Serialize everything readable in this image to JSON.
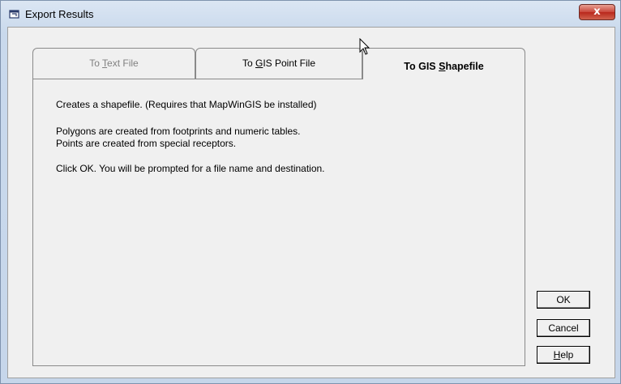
{
  "window": {
    "title": "Export Results",
    "close_label": "x"
  },
  "tabs": [
    {
      "label_prefix": "To ",
      "label_mnemonic": "T",
      "label_suffix": "ext File",
      "state": "disabled"
    },
    {
      "label_prefix": "To ",
      "label_mnemonic": "G",
      "label_suffix": "IS Point File",
      "state": "inactive"
    },
    {
      "label_prefix": "To GIS ",
      "label_mnemonic": "S",
      "label_suffix": "hapefile",
      "state": "active"
    }
  ],
  "panel": {
    "line1": "Creates a shapefile. (Requires that MapWinGIS be installed)",
    "line2": "Polygons are created from footprints and numeric tables.",
    "line3": "Points are created from special receptors.",
    "line4": "Click OK.  You will be prompted for a file name and destination."
  },
  "buttons": {
    "ok": "OK",
    "cancel": "Cancel",
    "help_mnemonic": "H",
    "help_suffix": "elp"
  }
}
